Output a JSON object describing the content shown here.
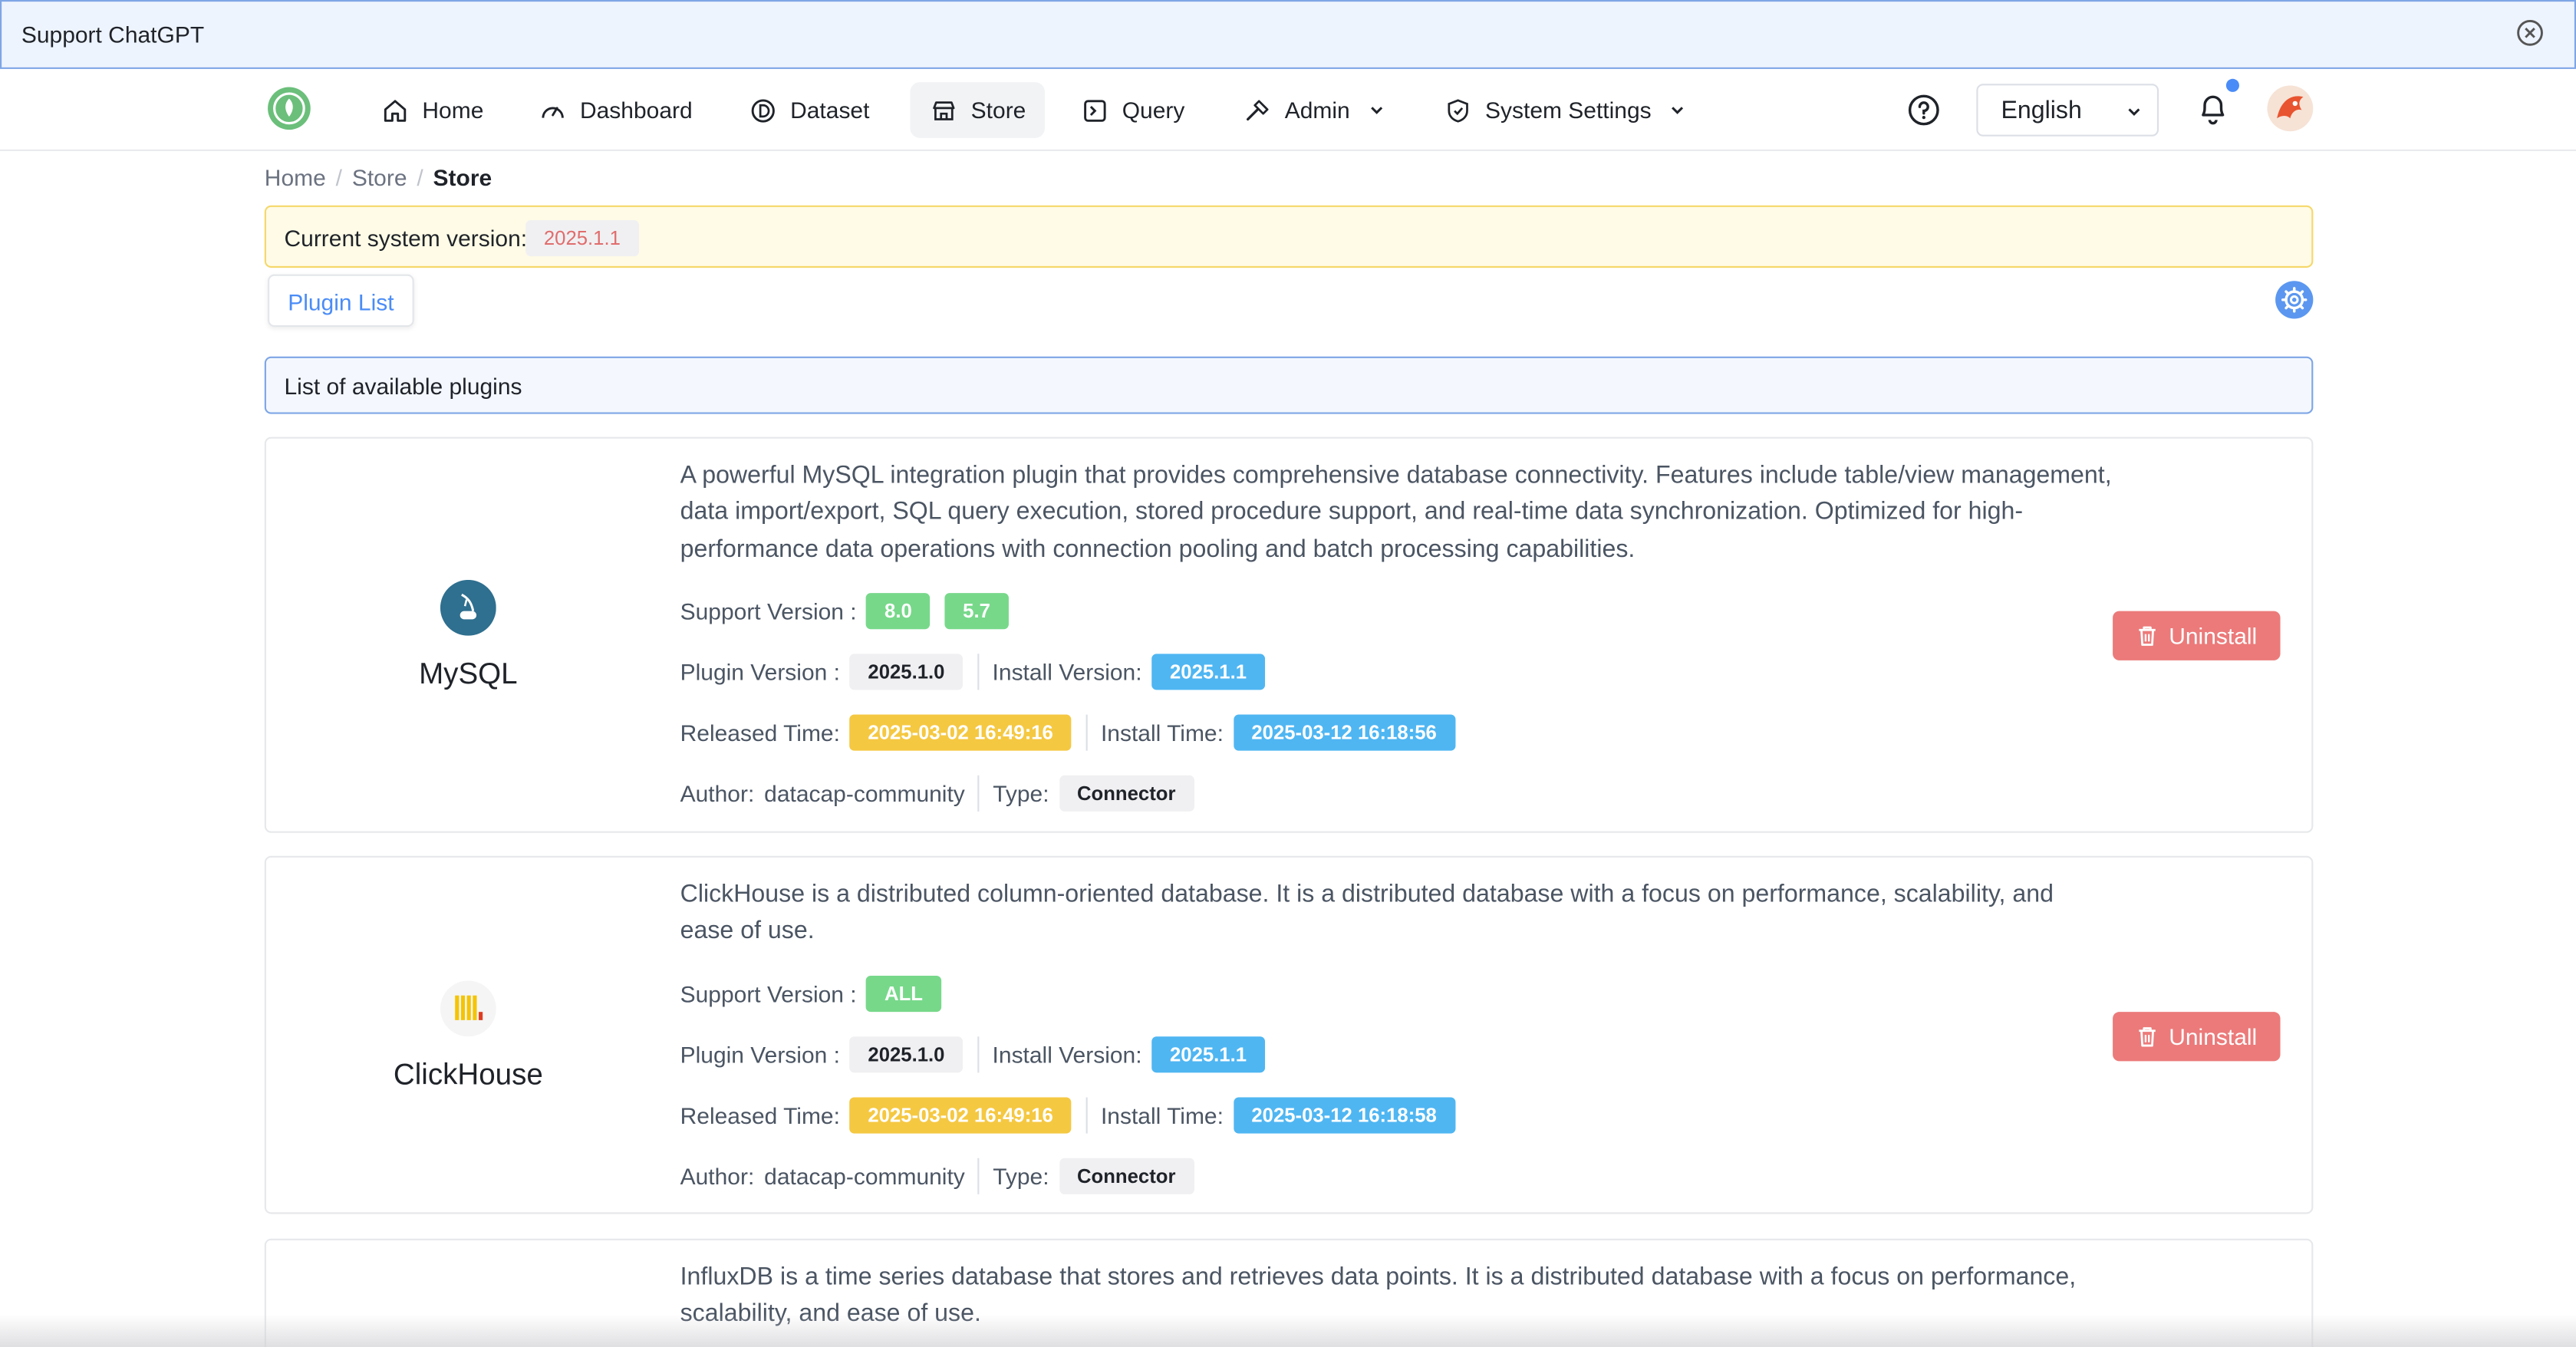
{
  "banner": {
    "text": "Support ChatGPT"
  },
  "nav": {
    "items": [
      {
        "label": "Home",
        "icon": "home-icon"
      },
      {
        "label": "Dashboard",
        "icon": "gauge-icon"
      },
      {
        "label": "Dataset",
        "icon": "dataset-icon"
      },
      {
        "label": "Store",
        "icon": "store-icon"
      },
      {
        "label": "Query",
        "icon": "terminal-icon"
      },
      {
        "label": "Admin",
        "icon": "hammer-icon"
      },
      {
        "label": "System Settings",
        "icon": "shield-icon"
      }
    ],
    "active": "Store",
    "language": "English"
  },
  "breadcrumb": [
    "Home",
    "Store",
    "Store"
  ],
  "version": {
    "label": "Current system version:",
    "value": "2025.1.1"
  },
  "tab": {
    "label": "Plugin List"
  },
  "list_header": "List of available plugins",
  "labels": {
    "support_version": "Support Version :",
    "plugin_version": "Plugin Version :",
    "install_version": "Install Version:",
    "released_time": "Released Time:",
    "install_time": "Install Time:",
    "author": "Author:",
    "type": "Type:",
    "uninstall": "Uninstall"
  },
  "plugins": [
    {
      "name": "MySQL",
      "description": "A powerful MySQL integration plugin that provides comprehensive database connectivity. Features include table/view management, data import/export, SQL query execution, stored procedure support, and real-time data synchronization. Optimized for high-performance data operations with connection pooling and batch processing capabilities.",
      "support_versions": [
        "8.0",
        "5.7"
      ],
      "plugin_version": "2025.1.0",
      "install_version": "2025.1.1",
      "released_time": "2025-03-02 16:49:16",
      "install_time": "2025-03-12 16:18:56",
      "author": "datacap-community",
      "type": "Connector"
    },
    {
      "name": "ClickHouse",
      "description": "ClickHouse is a distributed column-oriented database. It is a distributed database with a focus on performance, scalability, and ease of use.",
      "support_versions": [
        "ALL"
      ],
      "plugin_version": "2025.1.0",
      "install_version": "2025.1.1",
      "released_time": "2025-03-02 16:49:16",
      "install_time": "2025-03-12 16:18:58",
      "author": "datacap-community",
      "type": "Connector"
    },
    {
      "description": "InfluxDB is a time series database that stores and retrieves data points. It is a distributed database with a focus on performance, scalability, and ease of use."
    }
  ],
  "colors": {
    "accent": "#4a8cf7",
    "danger": "#ec7a7a",
    "success": "#77d88a",
    "info": "#4fb6f2",
    "warning": "#f5c842"
  }
}
